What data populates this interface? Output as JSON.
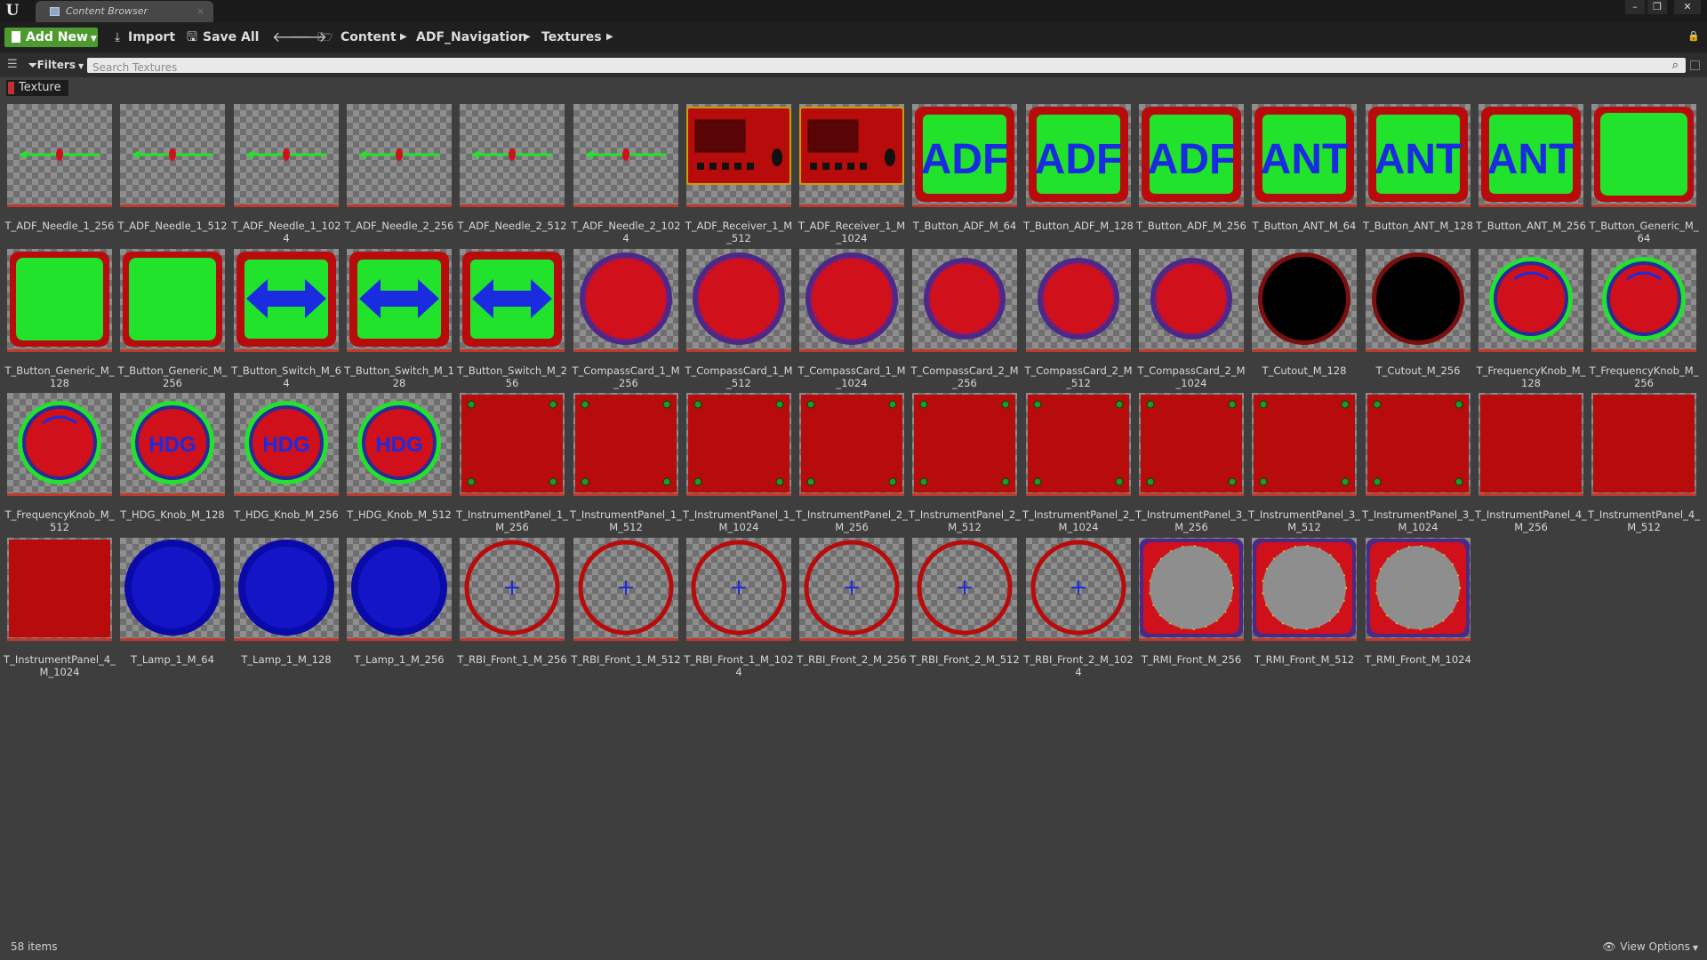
{
  "window": {
    "tab_title": "Content Browser",
    "tab_close": "×",
    "min_glyph": "–",
    "max_glyph": "❐",
    "close_glyph": "✕"
  },
  "toolbar": {
    "add_new_label": "Add New",
    "import_label": "Import",
    "save_all_label": "Save All",
    "breadcrumbs": [
      "Content",
      "ADF_Navigation",
      "Textures"
    ]
  },
  "filter": {
    "filters_label": "Filters",
    "search_placeholder": "Search Textures",
    "active_filter": "Texture",
    "active_filter_color": "#c03030"
  },
  "assets": [
    {
      "name": "T_ADF_Needle_1_256",
      "kind": "needle"
    },
    {
      "name": "T_ADF_Needle_1_512",
      "kind": "needle"
    },
    {
      "name": "T_ADF_Needle_1_1024",
      "kind": "needle"
    },
    {
      "name": "T_ADF_Needle_2_256",
      "kind": "needle"
    },
    {
      "name": "T_ADF_Needle_2_512",
      "kind": "needle"
    },
    {
      "name": "T_ADF_Needle_2_1024",
      "kind": "needle"
    },
    {
      "name": "T_ADF_Receiver_1_M_512",
      "kind": "receiver"
    },
    {
      "name": "T_ADF_Receiver_1_M_1024",
      "kind": "receiver"
    },
    {
      "name": "T_Button_ADF_M_64",
      "kind": "button-text",
      "text": "ADF"
    },
    {
      "name": "T_Button_ADF_M_128",
      "kind": "button-text",
      "text": "ADF"
    },
    {
      "name": "T_Button_ADF_M_256",
      "kind": "button-text",
      "text": "ADF"
    },
    {
      "name": "T_Button_ANT_M_64",
      "kind": "button-text",
      "text": "ANT"
    },
    {
      "name": "T_Button_ANT_M_128",
      "kind": "button-text",
      "text": "ANT"
    },
    {
      "name": "T_Button_ANT_M_256",
      "kind": "button-text",
      "text": "ANT"
    },
    {
      "name": "T_Button_Generic_M_64",
      "kind": "button-generic"
    },
    {
      "name": "T_Button_Generic_M_128",
      "kind": "button-generic"
    },
    {
      "name": "T_Button_Generic_M_256",
      "kind": "button-generic"
    },
    {
      "name": "T_Button_Switch_M_64",
      "kind": "button-switch"
    },
    {
      "name": "T_Button_Switch_M_128",
      "kind": "button-switch"
    },
    {
      "name": "T_Button_Switch_M_256",
      "kind": "button-switch"
    },
    {
      "name": "T_CompassCard_1_M_256",
      "kind": "compass"
    },
    {
      "name": "T_CompassCard_1_M_512",
      "kind": "compass"
    },
    {
      "name": "T_CompassCard_1_M_1024",
      "kind": "compass"
    },
    {
      "name": "T_CompassCard_2_M_256",
      "kind": "compass-small"
    },
    {
      "name": "T_CompassCard_2_M_512",
      "kind": "compass-small"
    },
    {
      "name": "T_CompassCard_2_M_1024",
      "kind": "compass-small"
    },
    {
      "name": "T_Cutout_M_128",
      "kind": "cutout"
    },
    {
      "name": "T_Cutout_M_256",
      "kind": "cutout"
    },
    {
      "name": "T_FrequencyKnob_M_128",
      "kind": "freq-knob"
    },
    {
      "name": "T_FrequencyKnob_M_256",
      "kind": "freq-knob"
    },
    {
      "name": "T_FrequencyKnob_M_512",
      "kind": "freq-knob"
    },
    {
      "name": "T_HDG_Knob_M_128",
      "kind": "hdg-knob",
      "text": "HDG"
    },
    {
      "name": "T_HDG_Knob_M_256",
      "kind": "hdg-knob",
      "text": "HDG"
    },
    {
      "name": "T_HDG_Knob_M_512",
      "kind": "hdg-knob",
      "text": "HDG"
    },
    {
      "name": "T_InstrumentPanel_1_M_256",
      "kind": "panel-dots"
    },
    {
      "name": "T_InstrumentPanel_1_M_512",
      "kind": "panel-dots"
    },
    {
      "name": "T_InstrumentPanel_1_M_1024",
      "kind": "panel-dots"
    },
    {
      "name": "T_InstrumentPanel_2_M_256",
      "kind": "panel-dots"
    },
    {
      "name": "T_InstrumentPanel_2_M_512",
      "kind": "panel-dots"
    },
    {
      "name": "T_InstrumentPanel_2_M_1024",
      "kind": "panel-dots"
    },
    {
      "name": "T_InstrumentPanel_3_M_256",
      "kind": "panel-dots"
    },
    {
      "name": "T_InstrumentPanel_3_M_512",
      "kind": "panel-dots"
    },
    {
      "name": "T_InstrumentPanel_3_M_1024",
      "kind": "panel-dots"
    },
    {
      "name": "T_InstrumentPanel_4_M_256",
      "kind": "panel-plain"
    },
    {
      "name": "T_InstrumentPanel_4_M_512",
      "kind": "panel-plain"
    },
    {
      "name": "T_InstrumentPanel_4_M_1024",
      "kind": "panel-plain"
    },
    {
      "name": "T_Lamp_1_M_64",
      "kind": "lamp"
    },
    {
      "name": "T_Lamp_1_M_128",
      "kind": "lamp"
    },
    {
      "name": "T_Lamp_1_M_256",
      "kind": "lamp"
    },
    {
      "name": "T_RBI_Front_1_M_256",
      "kind": "rbi"
    },
    {
      "name": "T_RBI_Front_1_M_512",
      "kind": "rbi"
    },
    {
      "name": "T_RBI_Front_1_M_1024",
      "kind": "rbi"
    },
    {
      "name": "T_RBI_Front_2_M_256",
      "kind": "rbi"
    },
    {
      "name": "T_RBI_Front_2_M_512",
      "kind": "rbi"
    },
    {
      "name": "T_RBI_Front_2_M_1024",
      "kind": "rbi"
    },
    {
      "name": "T_RMI_Front_M_256",
      "kind": "rmi"
    },
    {
      "name": "T_RMI_Front_M_512",
      "kind": "rmi"
    },
    {
      "name": "T_RMI_Front_M_1024",
      "kind": "rmi"
    }
  ],
  "status": {
    "item_count": "58 items",
    "view_options_label": "View Options"
  },
  "colors": {
    "add_new_green": "#4d9a2e",
    "texture_underline": "#c0392b"
  }
}
